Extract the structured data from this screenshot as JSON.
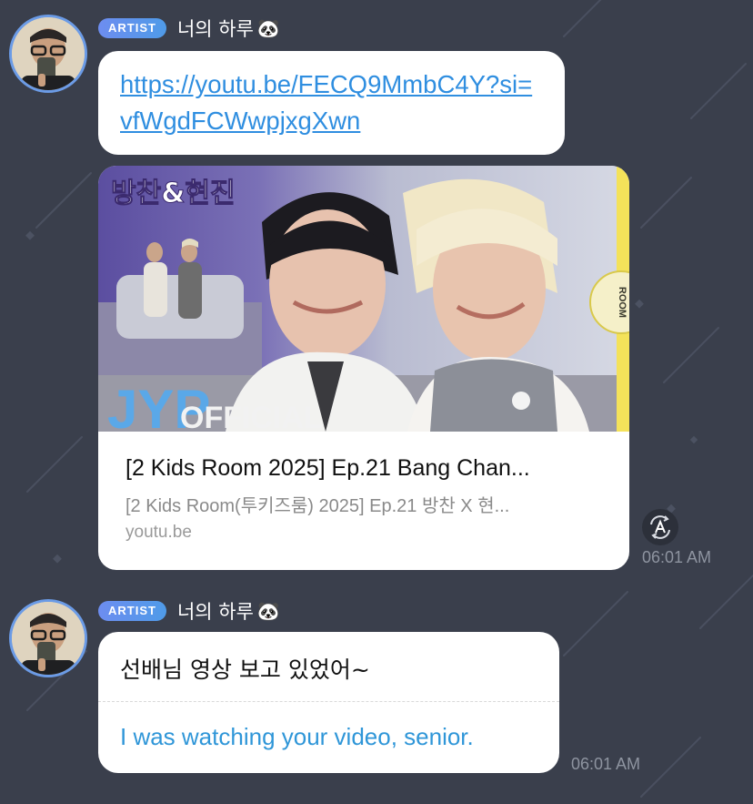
{
  "messages": [
    {
      "badge": "ARTIST",
      "sender": "너의 하루",
      "sender_emoji": "🐼",
      "link": "https://youtu.be/FECQ9MmbC4Y?si=vfWgdFCWwpjxgXwn",
      "preview": {
        "overlay_title": "방찬&현진",
        "overlay_brand": "JYP",
        "overlay_sub": "OFFICIAL",
        "side_badge_text": "ROOM",
        "title": "[2 Kids Room 2025] Ep.21 Bang Chan...",
        "description": "[2 Kids Room(투키즈룸) 2025] Ep.21 방찬 X 현...",
        "domain": "youtu.be"
      },
      "time": "06:01 AM"
    },
    {
      "badge": "ARTIST",
      "sender": "너의 하루",
      "sender_emoji": "🐼",
      "text": "선배님 영상 보고 있었어~",
      "translation": "I was watching your video, senior.",
      "time": "06:01 AM"
    }
  ],
  "colors": {
    "background": "#3a3f4c",
    "badge": "#5f93ee",
    "link": "#2f8ee0",
    "translation": "#2f96d8"
  },
  "icons": {
    "translate": "translate-icon",
    "avatar": "avatar"
  }
}
